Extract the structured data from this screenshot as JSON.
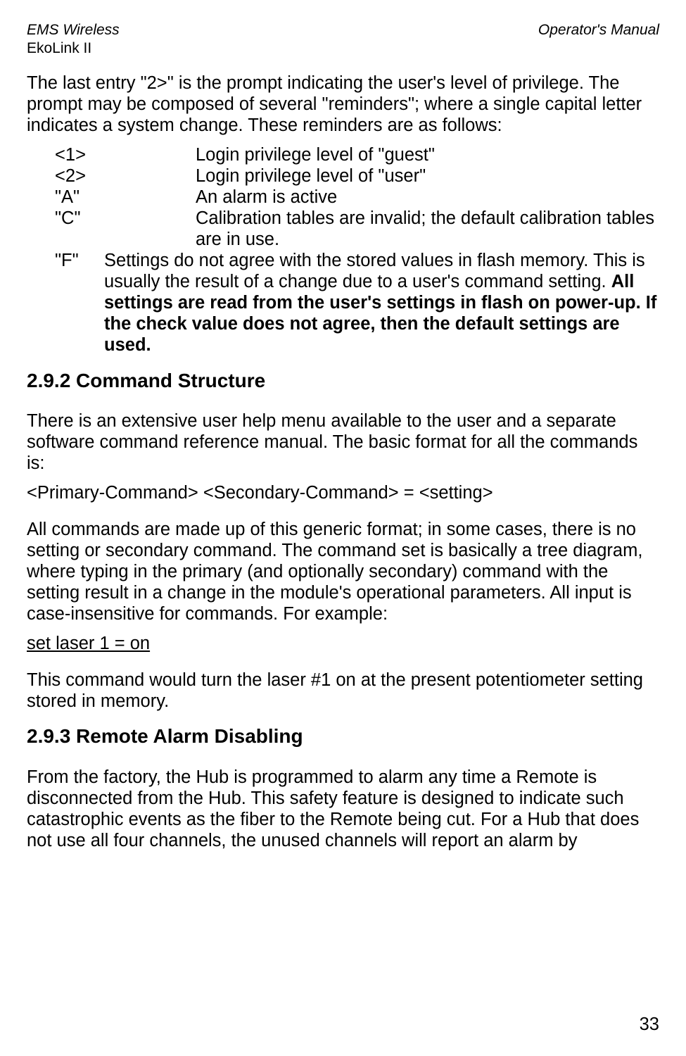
{
  "header": {
    "left_line1": "EMS Wireless",
    "left_line2": "EkoLink II",
    "right": "Operator's Manual"
  },
  "intro_para": "The last entry \"2>\" is the prompt indicating the user's level of privilege.  The prompt may be composed of several \"reminders\"; where a single capital letter indicates a system change.  These reminders are as follows:",
  "defs": {
    "r1_key": "<1>",
    "r1_val": "Login privilege level of \"guest\"",
    "r2_key": "<2>",
    "r2_val": "Login privilege level of \"user\"",
    "r3_key": "\"A\"",
    "r3_val": "An alarm is active",
    "r4_key": "\"C\"",
    "r4_val": "Calibration tables are invalid; the default calibration tables are in use.",
    "r5_key": "\"F\"",
    "r5_val_plain": "Settings do not agree with the stored values in flash memory.  This is usually the result of a change due to a user's command setting.  ",
    "r5_val_bold": "All settings are read from the user's settings in flash on power-up.  If the check value does not agree, then the default settings are used."
  },
  "section_292_title": "2.9.2 Command Structure",
  "section_292_p1": "There is an extensive user help menu available to the user and a separate software command reference manual.  The basic format for all the commands is:",
  "section_292_cmdformat": "<Primary-Command> <Secondary-Command> = <setting>",
  "section_292_p2": "All commands are made up of this generic format; in some cases, there is no setting or secondary command.  The command set is basically a tree diagram, where typing in the primary (and optionally secondary) command with the setting result in a change in the module's operational parameters.  All input is case-insensitive for commands.  For example:",
  "section_292_example": "set laser 1 = on",
  "section_292_p3": "This command would turn the laser #1 on at the present potentiometer setting stored in memory.",
  "section_293_title": "2.9.3  Remote Alarm Disabling",
  "section_293_p1": "From the factory, the Hub is programmed to alarm any time a Remote is disconnected from the Hub.  This safety feature is designed to indicate such catastrophic events as the fiber to the Remote being cut.  For a Hub that does not use all four channels, the unused channels will report an alarm by",
  "page_number": "33"
}
